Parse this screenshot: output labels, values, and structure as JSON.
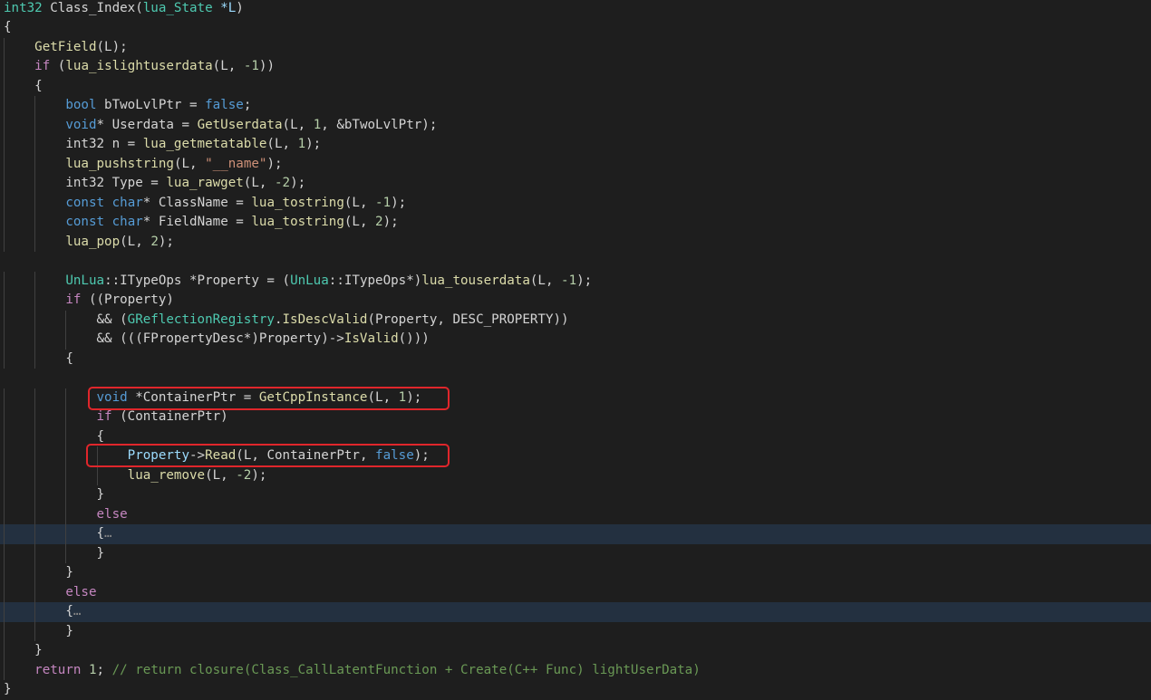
{
  "editor": {
    "lines": [
      [
        [
          "ty",
          "int32"
        ],
        [
          "",
          " Class_Index("
        ],
        [
          "ty",
          "lua_State"
        ],
        [
          "",
          ""
        ],
        [
          "var",
          " *L"
        ],
        [
          "",
          ")"
        ]
      ],
      [
        [
          "",
          "{"
        ]
      ],
      [
        [
          "",
          "    "
        ],
        [
          "fn",
          "GetField"
        ],
        [
          "",
          "(L);"
        ]
      ],
      [
        [
          "",
          "    "
        ],
        [
          "ctl",
          "if"
        ],
        [
          "",
          " ("
        ],
        [
          "fn",
          "lua_islightuserdata"
        ],
        [
          "",
          "(L, "
        ],
        [
          "num",
          "-1"
        ],
        [
          "",
          "))"
        ]
      ],
      [
        [
          "",
          "    {"
        ]
      ],
      [
        [
          "",
          "        "
        ],
        [
          "kw",
          "bool"
        ],
        [
          "",
          " bTwoLvlPtr = "
        ],
        [
          "kw",
          "false"
        ],
        [
          "",
          ";"
        ]
      ],
      [
        [
          "",
          "        "
        ],
        [
          "kw",
          "void"
        ],
        [
          "",
          "* Userdata = "
        ],
        [
          "fn",
          "GetUserdata"
        ],
        [
          "",
          "(L, "
        ],
        [
          "num",
          "1"
        ],
        [
          "",
          ", &bTwoLvlPtr);"
        ]
      ],
      [
        [
          "",
          "        int32 n = "
        ],
        [
          "fn",
          "lua_getmetatable"
        ],
        [
          "",
          "(L, "
        ],
        [
          "num",
          "1"
        ],
        [
          "",
          ");"
        ]
      ],
      [
        [
          "",
          "        "
        ],
        [
          "fn",
          "lua_pushstring"
        ],
        [
          "",
          "(L, "
        ],
        [
          "str",
          "\"__name\""
        ],
        [
          "",
          ");"
        ]
      ],
      [
        [
          "",
          "        int32 Type = "
        ],
        [
          "fn",
          "lua_rawget"
        ],
        [
          "",
          "(L, "
        ],
        [
          "num",
          "-2"
        ],
        [
          "",
          ");"
        ]
      ],
      [
        [
          "",
          "        "
        ],
        [
          "kw",
          "const"
        ],
        [
          "",
          " "
        ],
        [
          "kw",
          "char"
        ],
        [
          "",
          "* ClassName = "
        ],
        [
          "fn",
          "lua_tostring"
        ],
        [
          "",
          "(L, "
        ],
        [
          "num",
          "-1"
        ],
        [
          "",
          ");"
        ]
      ],
      [
        [
          "",
          "        "
        ],
        [
          "kw",
          "const"
        ],
        [
          "",
          " "
        ],
        [
          "kw",
          "char"
        ],
        [
          "",
          "* FieldName = "
        ],
        [
          "fn",
          "lua_tostring"
        ],
        [
          "",
          "(L, "
        ],
        [
          "num",
          "2"
        ],
        [
          "",
          ");"
        ]
      ],
      [
        [
          "",
          "        "
        ],
        [
          "fn",
          "lua_pop"
        ],
        [
          "",
          "(L, "
        ],
        [
          "num",
          "2"
        ],
        [
          "",
          ");"
        ]
      ],
      [
        [
          "",
          ""
        ]
      ],
      [
        [
          "",
          "        "
        ],
        [
          "ty",
          "UnLua"
        ],
        [
          "",
          "::ITypeOps *Property = ("
        ],
        [
          "ty",
          "UnLua"
        ],
        [
          "",
          "::ITypeOps*)"
        ],
        [
          "fn",
          "lua_touserdata"
        ],
        [
          "",
          "(L, "
        ],
        [
          "num",
          "-1"
        ],
        [
          "",
          ");"
        ]
      ],
      [
        [
          "",
          "        "
        ],
        [
          "ctl",
          "if"
        ],
        [
          "",
          " ((Property)"
        ]
      ],
      [
        [
          "",
          "            && ("
        ],
        [
          "ty",
          "GReflectionRegistry"
        ],
        [
          "",
          "."
        ],
        [
          "fn",
          "IsDescValid"
        ],
        [
          "",
          "(Property, DESC_PROPERTY))"
        ]
      ],
      [
        [
          "",
          "            && (((FPropertyDesc*)Property)->"
        ],
        [
          "fn",
          "IsValid"
        ],
        [
          "",
          "()))"
        ]
      ],
      [
        [
          "",
          "        {"
        ]
      ],
      [
        [
          "",
          ""
        ]
      ],
      [
        [
          "",
          "            "
        ],
        [
          "kw",
          "void"
        ],
        [
          "",
          " *ContainerPtr = "
        ],
        [
          "fn",
          "GetCppInstance"
        ],
        [
          "",
          "(L, "
        ],
        [
          "num",
          "1"
        ],
        [
          "",
          ");"
        ]
      ],
      [
        [
          "",
          "            "
        ],
        [
          "ctl",
          "if"
        ],
        [
          "",
          " (ContainerPtr)"
        ]
      ],
      [
        [
          "",
          "            {"
        ]
      ],
      [
        [
          "",
          "                "
        ],
        [
          "var",
          "Property"
        ],
        [
          "",
          "->"
        ],
        [
          "fn",
          "Read"
        ],
        [
          "",
          "(L, ContainerPtr, "
        ],
        [
          "kw",
          "false"
        ],
        [
          "",
          ");"
        ]
      ],
      [
        [
          "",
          "                "
        ],
        [
          "fn",
          "lua_remove"
        ],
        [
          "",
          "(L, "
        ],
        [
          "num",
          "-2"
        ],
        [
          "",
          ");"
        ]
      ],
      [
        [
          "",
          "            }"
        ]
      ],
      [
        [
          "",
          "            "
        ],
        [
          "ctl",
          "else"
        ]
      ],
      [
        [
          "",
          "            {"
        ],
        [
          "fold",
          "…"
        ]
      ],
      [
        [
          "",
          "            }"
        ]
      ],
      [
        [
          "",
          "        }"
        ]
      ],
      [
        [
          "",
          "        "
        ],
        [
          "ctl",
          "else"
        ]
      ],
      [
        [
          "",
          "        {"
        ],
        [
          "fold",
          "…"
        ]
      ],
      [
        [
          "",
          "        }"
        ]
      ],
      [
        [
          "",
          "    }"
        ]
      ],
      [
        [
          "",
          "    "
        ],
        [
          "ctl",
          "return"
        ],
        [
          "",
          " "
        ],
        [
          "num",
          "1"
        ],
        [
          "",
          "; "
        ],
        [
          "cm",
          "// return closure(Class_CallLatentFunction + Create(C++ Func) lightUserData)"
        ]
      ],
      [
        [
          "",
          "}"
        ]
      ]
    ],
    "highlighted_lines": [
      27,
      31
    ],
    "colors": {
      "background": "#1e1e1e",
      "keyword": "#569cd6",
      "control": "#c586c0",
      "function": "#dcdcaa",
      "type": "#4ec9b0",
      "number": "#b5cea8",
      "string": "#ce9178",
      "comment": "#6a9955",
      "annotation_box": "#e0262b"
    },
    "annotation_boxes": [
      {
        "name": "annotation-box-get-cpp-instance",
        "line": 20
      },
      {
        "name": "annotation-box-property-read",
        "line": 23
      }
    ]
  }
}
